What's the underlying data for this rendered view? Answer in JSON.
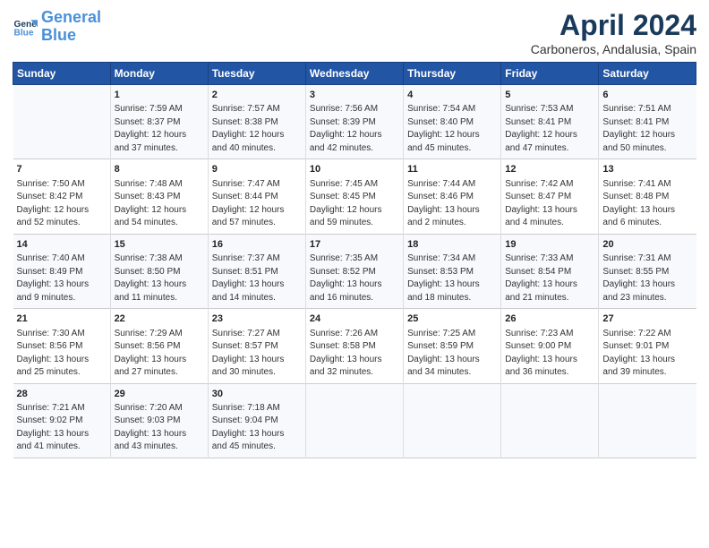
{
  "header": {
    "logo_line1": "General",
    "logo_line2": "Blue",
    "title": "April 2024",
    "subtitle": "Carboneros, Andalusia, Spain"
  },
  "columns": [
    "Sunday",
    "Monday",
    "Tuesday",
    "Wednesday",
    "Thursday",
    "Friday",
    "Saturday"
  ],
  "weeks": [
    [
      {
        "num": "",
        "info": ""
      },
      {
        "num": "1",
        "info": "Sunrise: 7:59 AM\nSunset: 8:37 PM\nDaylight: 12 hours\nand 37 minutes."
      },
      {
        "num": "2",
        "info": "Sunrise: 7:57 AM\nSunset: 8:38 PM\nDaylight: 12 hours\nand 40 minutes."
      },
      {
        "num": "3",
        "info": "Sunrise: 7:56 AM\nSunset: 8:39 PM\nDaylight: 12 hours\nand 42 minutes."
      },
      {
        "num": "4",
        "info": "Sunrise: 7:54 AM\nSunset: 8:40 PM\nDaylight: 12 hours\nand 45 minutes."
      },
      {
        "num": "5",
        "info": "Sunrise: 7:53 AM\nSunset: 8:41 PM\nDaylight: 12 hours\nand 47 minutes."
      },
      {
        "num": "6",
        "info": "Sunrise: 7:51 AM\nSunset: 8:41 PM\nDaylight: 12 hours\nand 50 minutes."
      }
    ],
    [
      {
        "num": "7",
        "info": "Sunrise: 7:50 AM\nSunset: 8:42 PM\nDaylight: 12 hours\nand 52 minutes."
      },
      {
        "num": "8",
        "info": "Sunrise: 7:48 AM\nSunset: 8:43 PM\nDaylight: 12 hours\nand 54 minutes."
      },
      {
        "num": "9",
        "info": "Sunrise: 7:47 AM\nSunset: 8:44 PM\nDaylight: 12 hours\nand 57 minutes."
      },
      {
        "num": "10",
        "info": "Sunrise: 7:45 AM\nSunset: 8:45 PM\nDaylight: 12 hours\nand 59 minutes."
      },
      {
        "num": "11",
        "info": "Sunrise: 7:44 AM\nSunset: 8:46 PM\nDaylight: 13 hours\nand 2 minutes."
      },
      {
        "num": "12",
        "info": "Sunrise: 7:42 AM\nSunset: 8:47 PM\nDaylight: 13 hours\nand 4 minutes."
      },
      {
        "num": "13",
        "info": "Sunrise: 7:41 AM\nSunset: 8:48 PM\nDaylight: 13 hours\nand 6 minutes."
      }
    ],
    [
      {
        "num": "14",
        "info": "Sunrise: 7:40 AM\nSunset: 8:49 PM\nDaylight: 13 hours\nand 9 minutes."
      },
      {
        "num": "15",
        "info": "Sunrise: 7:38 AM\nSunset: 8:50 PM\nDaylight: 13 hours\nand 11 minutes."
      },
      {
        "num": "16",
        "info": "Sunrise: 7:37 AM\nSunset: 8:51 PM\nDaylight: 13 hours\nand 14 minutes."
      },
      {
        "num": "17",
        "info": "Sunrise: 7:35 AM\nSunset: 8:52 PM\nDaylight: 13 hours\nand 16 minutes."
      },
      {
        "num": "18",
        "info": "Sunrise: 7:34 AM\nSunset: 8:53 PM\nDaylight: 13 hours\nand 18 minutes."
      },
      {
        "num": "19",
        "info": "Sunrise: 7:33 AM\nSunset: 8:54 PM\nDaylight: 13 hours\nand 21 minutes."
      },
      {
        "num": "20",
        "info": "Sunrise: 7:31 AM\nSunset: 8:55 PM\nDaylight: 13 hours\nand 23 minutes."
      }
    ],
    [
      {
        "num": "21",
        "info": "Sunrise: 7:30 AM\nSunset: 8:56 PM\nDaylight: 13 hours\nand 25 minutes."
      },
      {
        "num": "22",
        "info": "Sunrise: 7:29 AM\nSunset: 8:56 PM\nDaylight: 13 hours\nand 27 minutes."
      },
      {
        "num": "23",
        "info": "Sunrise: 7:27 AM\nSunset: 8:57 PM\nDaylight: 13 hours\nand 30 minutes."
      },
      {
        "num": "24",
        "info": "Sunrise: 7:26 AM\nSunset: 8:58 PM\nDaylight: 13 hours\nand 32 minutes."
      },
      {
        "num": "25",
        "info": "Sunrise: 7:25 AM\nSunset: 8:59 PM\nDaylight: 13 hours\nand 34 minutes."
      },
      {
        "num": "26",
        "info": "Sunrise: 7:23 AM\nSunset: 9:00 PM\nDaylight: 13 hours\nand 36 minutes."
      },
      {
        "num": "27",
        "info": "Sunrise: 7:22 AM\nSunset: 9:01 PM\nDaylight: 13 hours\nand 39 minutes."
      }
    ],
    [
      {
        "num": "28",
        "info": "Sunrise: 7:21 AM\nSunset: 9:02 PM\nDaylight: 13 hours\nand 41 minutes."
      },
      {
        "num": "29",
        "info": "Sunrise: 7:20 AM\nSunset: 9:03 PM\nDaylight: 13 hours\nand 43 minutes."
      },
      {
        "num": "30",
        "info": "Sunrise: 7:18 AM\nSunset: 9:04 PM\nDaylight: 13 hours\nand 45 minutes."
      },
      {
        "num": "",
        "info": ""
      },
      {
        "num": "",
        "info": ""
      },
      {
        "num": "",
        "info": ""
      },
      {
        "num": "",
        "info": ""
      }
    ]
  ]
}
